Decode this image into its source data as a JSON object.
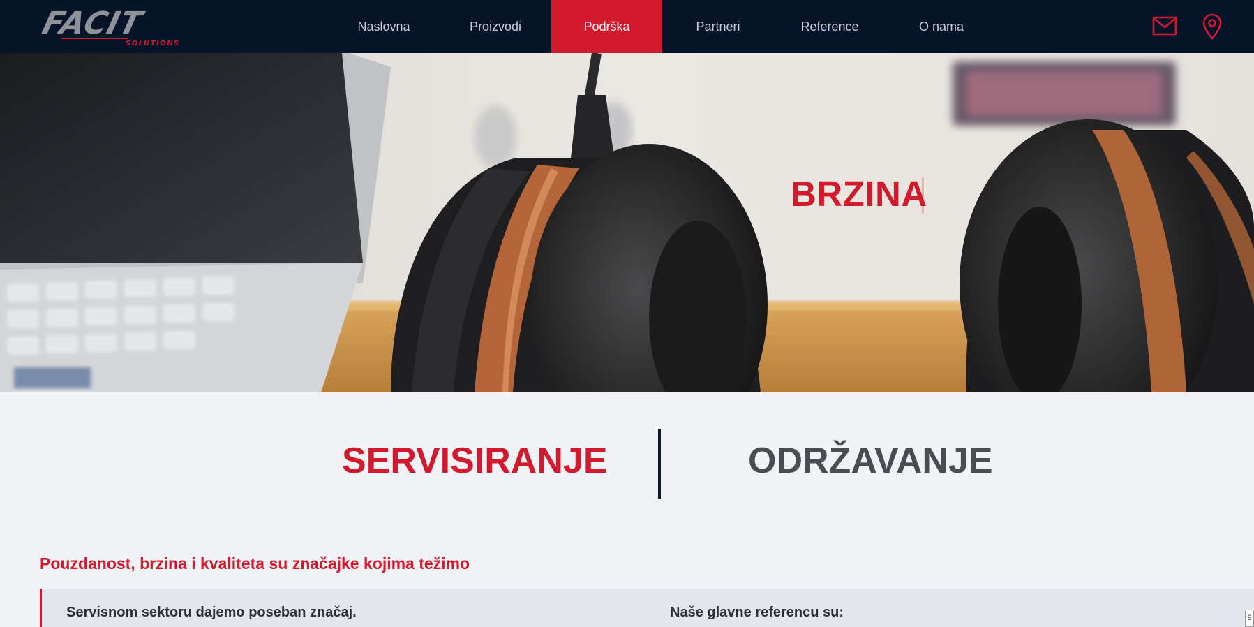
{
  "logo": {
    "word": "FACIT",
    "sub": "SOLUTIONS"
  },
  "nav": {
    "items": [
      {
        "label": "Naslovna"
      },
      {
        "label": "Proizvodi"
      },
      {
        "label": "Podrška"
      },
      {
        "label": "Partneri"
      },
      {
        "label": "Reference"
      },
      {
        "label": "O nama"
      }
    ],
    "active": "Podrška",
    "icons": [
      "mail-icon",
      "location-pin-icon"
    ]
  },
  "hero": {
    "text": "BRZINA"
  },
  "tabs": {
    "servis": "SERVISIRANJE",
    "odrzavanje": "ODRŽAVANJE",
    "active": "SERVISIRANJE"
  },
  "content": {
    "heading": "Pouzdanost, brzina i kvaliteta su značajke kojima težimo",
    "left_text": "Servisnom sektoru dajemo poseban značaj.",
    "right_text": "Naše glavne referencu su:"
  },
  "page_badge": "9",
  "colors": {
    "navbar": "#06142a",
    "accent": "#d21a2f",
    "background": "#f1f2f6"
  }
}
